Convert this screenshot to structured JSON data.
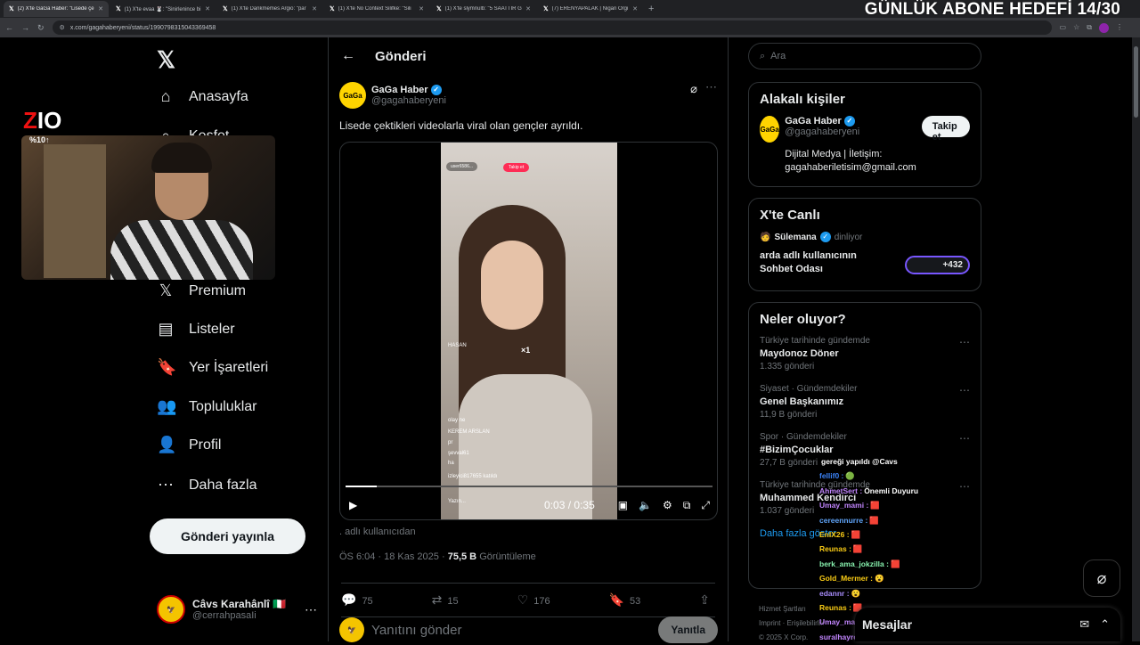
{
  "browser": {
    "tabs": [
      {
        "label": "(2) X'te GaGa Haber: \"Lisede çe",
        "active": true
      },
      {
        "label": "(1) X'te evaa 🐰: \"Sinirlenince bi"
      },
      {
        "label": "(1) X'te Dankmemes Argio: \"par"
      },
      {
        "label": "(1) X'te No Context Silifke: \"Sili"
      },
      {
        "label": "(1) X'te slymnulb: \"5 SAATTİR G"
      },
      {
        "label": "(7) ERENYAPALAK | Nigan Orgi"
      }
    ],
    "url": "x.com/gagahaberyeni/status/1990798315043369458"
  },
  "stream": {
    "goal": "GÜNLÜK ABONE HEDEFİ 14/30",
    "logo_a": "Z",
    "logo_b": "IO",
    "logo_sub": "%10↑"
  },
  "nav": {
    "items": [
      {
        "label": "Anasayfa",
        "icon": "home-icon",
        "glyph": "⌂"
      },
      {
        "label": "Keşfet",
        "icon": "search-icon",
        "glyph": "⌕"
      },
      {
        "label": "Premium",
        "icon": "x-icon",
        "glyph": "𝕏"
      },
      {
        "label": "Listeler",
        "icon": "list-icon",
        "glyph": "▤"
      },
      {
        "label": "Yer İşaretleri",
        "icon": "bookmark-icon",
        "glyph": "🔖"
      },
      {
        "label": "Topluluklar",
        "icon": "community-icon",
        "glyph": "👥"
      },
      {
        "label": "Profil",
        "icon": "profile-icon",
        "glyph": "👤"
      },
      {
        "label": "Daha fazla",
        "icon": "more-icon",
        "glyph": "⋯"
      }
    ],
    "post_button": "Gönderi yayınla",
    "me": {
      "name": "Câvs Karahânlî 🇮🇹",
      "handle": "@cerrahpasaIi"
    }
  },
  "post": {
    "header": "Gönderi",
    "author_name": "GaGa Haber",
    "author_handle": "@gagahaberyeni",
    "text": "Lisede çektikleri videolarla viral olan gençler ayrıldı.",
    "video": {
      "user": "user6586...",
      "follow": "Takip et",
      "time": "0:03 / 0:35",
      "progress": 0.086,
      "chat": [
        "HASAN",
        "×1",
        "olay ne",
        "KEREM ARSLAN",
        "pr",
        "şevval61",
        "ha",
        "izleyici817655 katıldı",
        "Yazın..."
      ]
    },
    "caption": ". adlı kullanıcıdan",
    "timestamp": "ÖS 6:04 · 18 Kas 2025 ·",
    "views": "75,5 B",
    "views_label": "Görüntüleme",
    "replies": "75",
    "reposts": "15",
    "likes": "176",
    "bookmarks": "53",
    "reply_placeholder": "Yanıtını gönder",
    "reply_button": "Yanıtla"
  },
  "right": {
    "search_placeholder": "Ara",
    "related_title": "Alakalı kişiler",
    "related": {
      "name": "GaGa Haber",
      "handle": "@gagahaberyeni",
      "bio": "Dijital Medya | İletişim: gagahaberiletisim@gmail.com",
      "follow": "Takip et"
    },
    "live_title": "X'te Canlı",
    "live": {
      "host": "Sülemana",
      "status": "dinliyor",
      "space": "arda adlı kullanıcının Sohbet Odası",
      "count": "+432"
    },
    "trends_title": "Neler oluyor?",
    "trends": [
      {
        "category": "Türkiye tarihinde gündemde",
        "title": "Maydonoz Döner",
        "count": "1.335 gönderi"
      },
      {
        "category": "Siyaset · Gündemdekiler",
        "title": "Genel Başkanımız",
        "count": "11,9 B gönderi"
      },
      {
        "category": "Spor · Gündemdekiler",
        "title": "#BizimÇocuklar",
        "count": "27,7 B gönderi"
      },
      {
        "category": "Türkiye tarihinde gündemde",
        "title": "Muhammed Kendirci",
        "count": "1.037 gönderi"
      }
    ],
    "show_more": "Daha fazla göster",
    "footer1": "Hizmet Şartları",
    "footer2": "Imprint · Erişilebilirlik",
    "footer3": "© 2025 X Corp."
  },
  "chat": [
    {
      "user": "",
      "msg": "gereği yapıldı @Cavs",
      "color": "#ffffff"
    },
    {
      "user": "fellif0 :",
      "msg": "🟢",
      "color": "#3b82f6"
    },
    {
      "user": "AhmetSert :",
      "msg": "Önemli Duyuru",
      "color": "#c084fc"
    },
    {
      "user": "Umay_mami :",
      "msg": "🟥",
      "color": "#c084fc"
    },
    {
      "user": "cereennurre :",
      "msg": "🟥",
      "color": "#60a5fa"
    },
    {
      "user": "EnIX26 :",
      "msg": "🟥",
      "color": "#facc15"
    },
    {
      "user": "Reunas :",
      "msg": "🟥",
      "color": "#facc15"
    },
    {
      "user": "berk_ama_jokzilla :",
      "msg": "🟥",
      "color": "#86efac"
    },
    {
      "user": "Gold_Mermer :",
      "msg": "😮",
      "color": "#facc15"
    },
    {
      "user": "edannr :",
      "msg": "😮",
      "color": "#a78bfa"
    },
    {
      "user": "Reunas :",
      "msg": "🟥",
      "color": "#facc15"
    },
    {
      "user": "Umay_mami :",
      "msg": "🟥",
      "color": "#c084fc"
    },
    {
      "user": "suralhayrettin :",
      "msg": "la olay ne",
      "color": "#c084fc"
    }
  ],
  "messages": {
    "title": "Mesajlar"
  }
}
